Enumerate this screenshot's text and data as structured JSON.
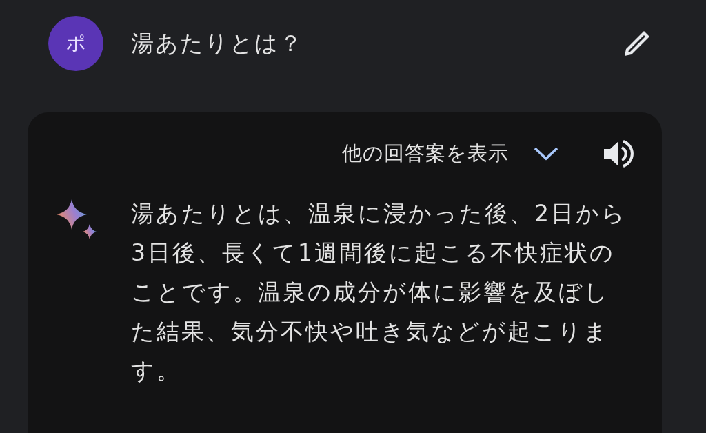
{
  "user_message": {
    "avatar_initial": "ポ",
    "text": "湯あたりとは？"
  },
  "response": {
    "drafts_label": "他の回答案を表示",
    "text": "湯あたりとは、温泉に浸かった後、2日から3日後、長くて1週間後に起こる不快症状のことです。温泉の成分が体に影響を及ぼした結果、気分不快や吐き気などが起こります。"
  }
}
